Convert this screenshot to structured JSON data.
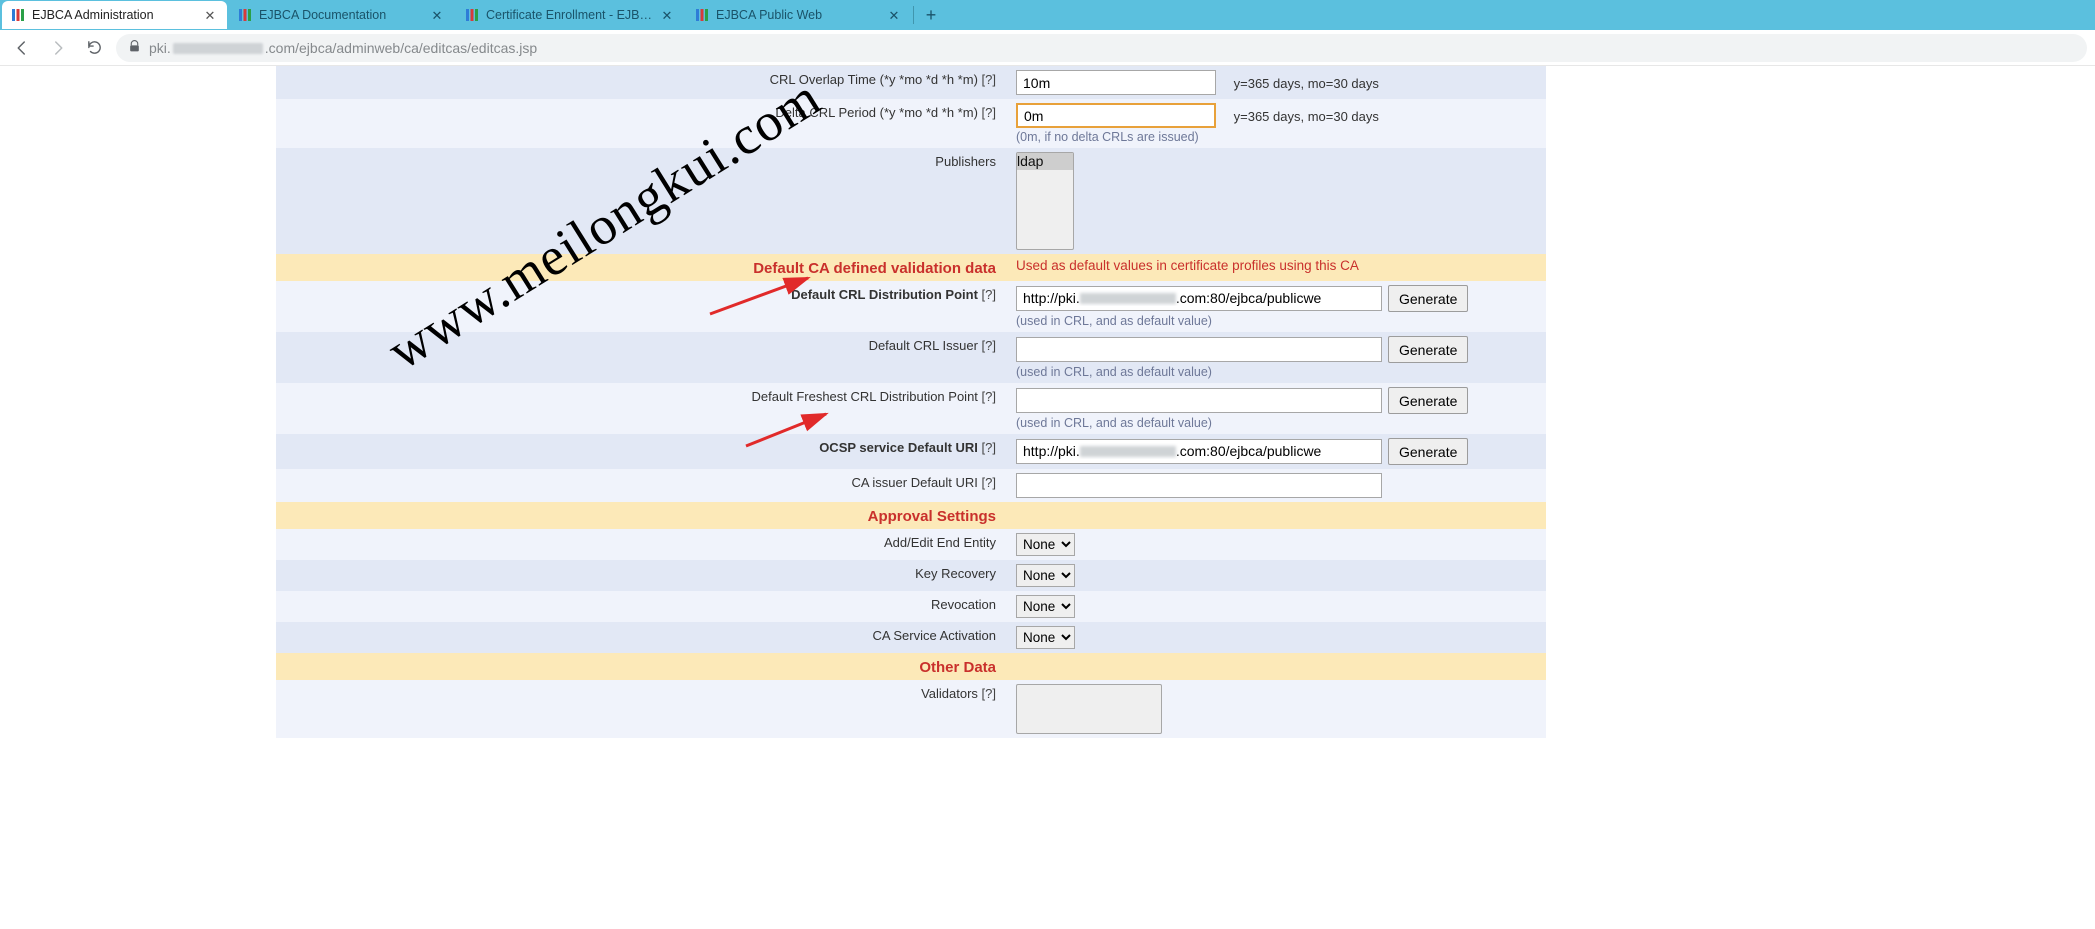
{
  "browser": {
    "tabs": [
      {
        "title": "EJBCA Administration"
      },
      {
        "title": "EJBCA Documentation"
      },
      {
        "title": "Certificate Enrollment - EJBCA"
      },
      {
        "title": "EJBCA Public Web"
      }
    ],
    "url_prefix": "pki.",
    "url_suffix": ".com/ejbca/adminweb/ca/editcas/editcas.jsp"
  },
  "crl": {
    "overlap_label": "CRL Overlap Time (*y *mo *d *h *m)",
    "overlap_value": "10m",
    "overlap_hint": "y=365 days, mo=30 days",
    "delta_label": "Delta CRL Period (*y *mo *d *h *m)",
    "delta_value": "0m",
    "delta_hint": "y=365 days, mo=30 days",
    "delta_sub": "(0m, if no delta CRLs are issued)",
    "publishers_label": "Publishers",
    "publishers_option": "ldap"
  },
  "validation": {
    "section_title": "Default CA defined validation data",
    "section_note": "Used as default values in certificate profiles using this CA",
    "cdp_label": "Default CRL Distribution Point",
    "cdp_prefix": "http://pki.",
    "cdp_suffix": ".com:80/ejbca/publicwe",
    "cdp_sub": "(used in CRL, and as default value)",
    "issuer_label": "Default CRL Issuer",
    "issuer_sub": "(used in CRL, and as default value)",
    "freshest_label": "Default Freshest CRL Distribution Point",
    "freshest_sub": "(used in CRL, and as default value)",
    "ocsp_label": "OCSP service Default URI",
    "ocsp_prefix": "http://pki.",
    "ocsp_suffix": ".com:80/ejbca/publicwe",
    "caissuer_label": "CA issuer Default URI",
    "generate_btn": "Generate"
  },
  "approval": {
    "section_title": "Approval Settings",
    "add_edit_label": "Add/Edit End Entity",
    "key_recovery_label": "Key Recovery",
    "revocation_label": "Revocation",
    "activation_label": "CA Service Activation",
    "option_none": "None"
  },
  "other": {
    "section_title": "Other Data",
    "validators_label": "Validators"
  },
  "help_q": "[?]",
  "watermark": "www.meilongkui.com"
}
